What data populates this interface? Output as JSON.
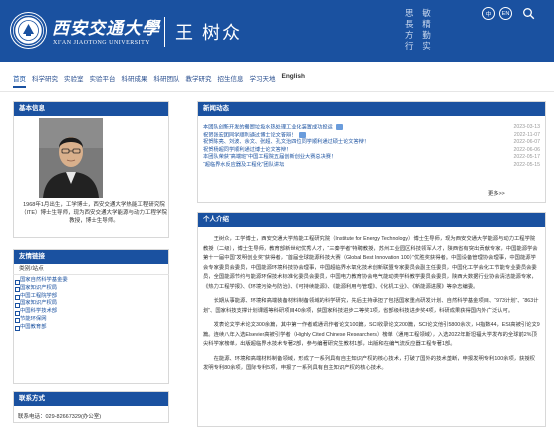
{
  "header": {
    "university_cn": "西安交通大學",
    "university_en": "XI'AN JIAOTONG UNIVERSITY",
    "person_name": "王 树众",
    "motto_lines": [
      "思 敏",
      "長 精",
      "方 勤",
      "行 实"
    ],
    "lang_cn": "中",
    "lang_en": "EN"
  },
  "nav": {
    "items": [
      "首页",
      "科学研究",
      "实验室",
      "实验平台",
      "科研成果",
      "科研团队",
      "教学研究",
      "招生信息",
      "学习天地",
      "English"
    ]
  },
  "basic_info": {
    "title": "基本信息",
    "caption": "1968年1月出生，工学博士，西安交通大学热能工程研究院（ITE）博士生导师，现为西安交通大学能源与动力工程学院教授，博士生导师。"
  },
  "links": {
    "title": "友情链接",
    "subtitle": "类别/站点",
    "items": [
      "国家自然科学基金委",
      "国家知识产权局",
      "中国工程院学部",
      "国家知识产权局",
      "中国科学技术部",
      "节能环保网",
      "中国教育部"
    ]
  },
  "contact": {
    "title": "联系方式",
    "phone": "联系电话：029-82667329(办公室)"
  },
  "news": {
    "title": "新闻动态",
    "more": "更多>>",
    "items": [
      {
        "title": "本团队创新开发的餐厨垃圾水热处理工业化装置成功投运",
        "new": true,
        "date": "2023-03-13"
      },
      {
        "title": "祝贺张宏团同学顺利通过博士论文答辩！",
        "new": true,
        "date": "2022-11-07"
      },
      {
        "title": "祝贺陈亮、刘波、余文、张超、孔文治四位同学顺利通过硕士论文答辩！",
        "new": false,
        "date": "2022-06-07"
      },
      {
        "title": "祝贺杨超同学顺利通过博士论文答辩！",
        "new": false,
        "date": "2022-06-06"
      },
      {
        "title": "本团队荣获“高端班”中国工程院五届创新创业大赛总决赛！",
        "new": false,
        "date": "2022-05-17"
      },
      {
        "title": "“超临界水反应器及工程化”团队讲坛",
        "new": false,
        "date": "2022-05-15"
      }
    ]
  },
  "intro": {
    "title": "个人介绍",
    "paragraphs": [
      "王树众，工学博士，西安交通大学热能工程研究院（Institute for Energy Technology）博士生导师，现为西安交通大学能源与动力工程学院教授（二级），博士生导师，教育部新世纪优秀人才，“三秦学者”特聘教授，苏州工业园区科技领军人才，陕西省有突出贡献专家，中国能源学会第十一届中国“发明创业奖”获得者，“首届全球能源科技大赛（Global Best Innovation 100）”优胜奖获得者。中国设备管理协会理事，中国能源学会专家委员会委员，中国能源环境科技协会理事，中国超临界水氧化技术创新联盟专家委员会副主任委员，中国化工学会化工节能专业委员会委员，全国能源节约与能源环保技术标准化委员会委员，中国电力教育协会电气能动类学科教学委员会委员，陕西大数据行业协会清洁能源专家，《热力工程学报》、《环境污染与防治》、《可持续能源》、《能源利用与管理》、《化机工业》、《新能源进展》等杂志编委。",
      "长期从事能源、环境和高端装备材料制备领域的科学研究，先后主持承担了包括国家重点研发计划、自然科学基金项目、“973计划”、“863计划”、国家科技支撑计划课题等科研项目40余项，获国家科技进步二等奖1项，省部级科技进步奖4项，科研成果获得国内外广泛认可。",
      "发表论文学术论文300余篇，其中第一作者或通讯作者论文100篇，SCI收录论文200篇，SCI论文他引5800余次，H指数44，ESI高被引论文9篇。连续八年入选Elsevier高被引学者（Highly Cited Chinese Researchers）榜单（通用工程领域），入选2022年斯坦福大学发布的全球前2%顶尖科学家榜单，出版超临界水技术专著2部，参与编著研究生教材1部，出版和在编气流反应器工程专著1部。",
      "在能源、环境和高端材料制备领域，形成了一系列具有自主知识产权的核心技术，打破了国外的技术垄断，申报发明专利100余项，获授权发明专利80余项，国际专利5项，申报了一系列具有自主知识产权的核心技术。"
    ]
  }
}
